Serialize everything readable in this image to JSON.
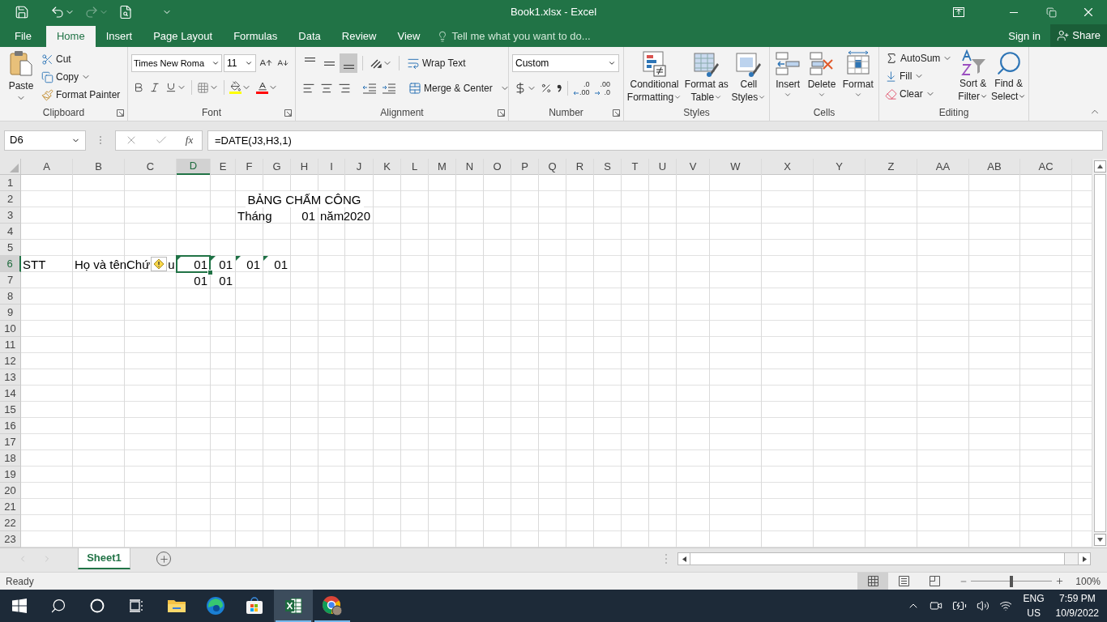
{
  "title_bar": {
    "title": "Book1.xlsx - Excel"
  },
  "menu_tabs": [
    {
      "label": "File",
      "selected": false
    },
    {
      "label": "Home",
      "selected": true
    },
    {
      "label": "Insert",
      "selected": false
    },
    {
      "label": "Page Layout",
      "selected": false
    },
    {
      "label": "Formulas",
      "selected": false
    },
    {
      "label": "Data",
      "selected": false
    },
    {
      "label": "Review",
      "selected": false
    },
    {
      "label": "View",
      "selected": false
    }
  ],
  "tell_me": {
    "placeholder": "Tell me what you want to do..."
  },
  "account": {
    "sign_in": "Sign in",
    "share": "Share"
  },
  "ribbon": {
    "clipboard": {
      "label": "Clipboard",
      "paste": "Paste",
      "cut": "Cut",
      "copy": "Copy",
      "format_painter": "Format Painter"
    },
    "font": {
      "label": "Font",
      "font_name": "Times New Roma",
      "font_size": "11"
    },
    "alignment": {
      "label": "Alignment",
      "vertical": [
        {
          "kind": "top",
          "selected": false
        },
        {
          "kind": "middle",
          "selected": false
        },
        {
          "kind": "bottom",
          "selected": true
        }
      ],
      "wrap_text": "Wrap Text",
      "merge": "Merge & Center"
    },
    "number": {
      "label": "Number",
      "format": "Custom",
      "decimals": [
        {
          "kind": "increase",
          "top": ".0",
          "bottom": ".00"
        },
        {
          "kind": "decrease",
          "top": ".00",
          "bottom": ".0"
        }
      ]
    },
    "styles": {
      "label": "Styles",
      "buttons": [
        {
          "kind": "conditional",
          "lines": [
            "Conditional",
            "Formatting"
          ]
        },
        {
          "kind": "table",
          "lines": [
            "Format as",
            "Table"
          ]
        },
        {
          "kind": "cell",
          "lines": [
            "Cell",
            "Styles"
          ]
        }
      ]
    },
    "cells": {
      "label": "Cells",
      "buttons": [
        {
          "kind": "insert",
          "label": "Insert"
        },
        {
          "kind": "delete",
          "label": "Delete"
        },
        {
          "kind": "format",
          "label": "Format"
        }
      ]
    },
    "editing": {
      "label": "Editing",
      "autosum": "AutoSum",
      "fill": "Fill",
      "clear": "Clear",
      "sort": [
        "Sort &",
        "Filter"
      ],
      "find": [
        "Find &",
        "Select"
      ]
    }
  },
  "formula_bar": {
    "name_box": "D6",
    "fx": "fx",
    "formula": "=DATE(J3,H3,1)"
  },
  "columns": [
    "A",
    "B",
    "C",
    "D",
    "E",
    "F",
    "G",
    "H",
    "I",
    "J",
    "K",
    "L",
    "M",
    "N",
    "O",
    "P",
    "Q",
    "R",
    "S",
    "T",
    "U",
    "V",
    "W",
    "X",
    "Y",
    "Z",
    "AA",
    "AB",
    "AC"
  ],
  "rows": [
    {
      "header": "1"
    },
    {
      "header": "2",
      "cells": [
        null,
        null,
        null,
        null,
        null,
        null,
        null,
        {
          "text": "BẢNG CHẤM CÔNG",
          "kind": "centered",
          "flag": false,
          "selected": false
        }
      ]
    },
    {
      "header": "3",
      "cells": [
        null,
        null,
        null,
        null,
        null,
        {
          "text": "Tháng",
          "kind": "text",
          "flag": false,
          "selected": false
        },
        null,
        {
          "text": "01",
          "kind": "number",
          "flag": false,
          "selected": false
        },
        {
          "text": "năm",
          "kind": "text",
          "flag": false,
          "selected": false
        },
        {
          "text": "2020",
          "kind": "number",
          "flag": false,
          "selected": false
        }
      ]
    },
    {
      "header": "4"
    },
    {
      "header": "5"
    },
    {
      "header": "6",
      "cells": [
        {
          "text": "STT",
          "kind": "text",
          "flag": false,
          "selected": false
        },
        {
          "text": "Họ và tên",
          "kind": "text",
          "flag": false,
          "selected": false
        },
        {
          "text": "Chứ",
          "text_after": "u",
          "error_button": true,
          "kind": "text",
          "flag": false,
          "selected": false
        },
        {
          "text": "01",
          "kind": "number",
          "flag": true,
          "selected": true
        },
        {
          "text": "01",
          "kind": "number",
          "flag": true,
          "selected": false
        },
        {
          "text": "01",
          "kind": "number",
          "flag": true,
          "selected": false
        },
        {
          "text": "01",
          "kind": "number",
          "flag": true,
          "selected": false
        }
      ]
    },
    {
      "header": "7",
      "cells": [
        null,
        null,
        null,
        {
          "text": "01",
          "kind": "number",
          "flag": false,
          "selected": false
        },
        {
          "text": "01",
          "kind": "number",
          "flag": false,
          "selected": false
        }
      ]
    },
    {
      "header": "8"
    },
    {
      "header": "9"
    },
    {
      "header": "10"
    },
    {
      "header": "11"
    },
    {
      "header": "12"
    },
    {
      "header": "13"
    },
    {
      "header": "14"
    },
    {
      "header": "15"
    },
    {
      "header": "16"
    },
    {
      "header": "17"
    },
    {
      "header": "18"
    },
    {
      "header": "19"
    },
    {
      "header": "20"
    },
    {
      "header": "21"
    },
    {
      "header": "22"
    },
    {
      "header": "23"
    }
  ],
  "sheet_tabs": [
    {
      "label": "Sheet1",
      "selected": true
    }
  ],
  "status_bar": {
    "status": "Ready",
    "views": [
      {
        "kind": "normal",
        "selected": true
      },
      {
        "kind": "page_layout",
        "selected": false
      },
      {
        "kind": "page_break",
        "selected": false
      }
    ],
    "zoom_slider": {
      "level": 0.5
    },
    "zoom": "100%"
  },
  "taskbar": {
    "apps": [
      {
        "kind": "start",
        "open": false,
        "active": false
      },
      {
        "kind": "search",
        "open": false,
        "active": false
      },
      {
        "kind": "cortana",
        "open": false,
        "active": false
      },
      {
        "kind": "task_view",
        "open": false,
        "active": false
      },
      {
        "kind": "explorer",
        "open": false,
        "active": false
      },
      {
        "kind": "edge",
        "open": false,
        "active": false
      },
      {
        "kind": "store",
        "open": false,
        "active": false
      },
      {
        "kind": "excel",
        "open": true,
        "active": true
      },
      {
        "kind": "chrome",
        "open": true,
        "active": false
      }
    ],
    "tray": {
      "language": "ENG",
      "region": "US",
      "time": "7:59 PM",
      "date": "10/9/2022"
    }
  }
}
